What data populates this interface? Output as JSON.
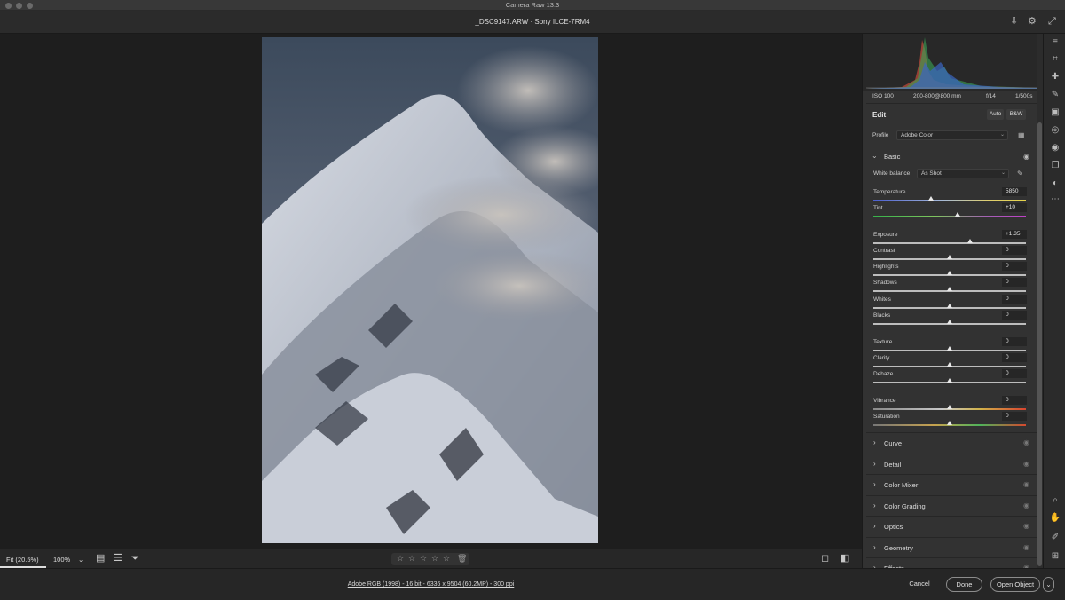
{
  "window": {
    "title": "Camera Raw 13.3"
  },
  "header": {
    "file_title": "_DSC9147.ARW  ·  Sony ILCE-7RM4",
    "save_icon": "save-icon",
    "settings_icon": "gear-icon",
    "fullscreen_icon": "expand-icon"
  },
  "histogram": {
    "iso": "ISO 100",
    "lens": "200-800@800 mm",
    "aperture": "f/14",
    "shutter": "1/500s"
  },
  "edit": {
    "title": "Edit",
    "auto_label": "Auto",
    "bw_label": "B&W",
    "profile_label": "Profile",
    "profile_value": "Adobe Color"
  },
  "basic": {
    "title": "Basic",
    "wb_label": "White balance",
    "wb_value": "As Shot",
    "sliders": [
      {
        "name": "Temperature",
        "value": "5850",
        "position": 0.38
      },
      {
        "name": "Tint",
        "value": "+10",
        "position": 0.55
      },
      {
        "name": "Exposure",
        "value": "+1.35",
        "position": 0.635
      },
      {
        "name": "Contrast",
        "value": "0",
        "position": 0.5
      },
      {
        "name": "Highlights",
        "value": "0",
        "position": 0.5
      },
      {
        "name": "Shadows",
        "value": "0",
        "position": 0.5
      },
      {
        "name": "Whites",
        "value": "0",
        "position": 0.5
      },
      {
        "name": "Blacks",
        "value": "0",
        "position": 0.5
      },
      {
        "name": "Texture",
        "value": "0",
        "position": 0.5
      },
      {
        "name": "Clarity",
        "value": "0",
        "position": 0.5
      },
      {
        "name": "Dehaze",
        "value": "0",
        "position": 0.5
      },
      {
        "name": "Vibrance",
        "value": "0",
        "position": 0.5
      },
      {
        "name": "Saturation",
        "value": "0",
        "position": 0.5
      }
    ]
  },
  "panels": [
    "Curve",
    "Detail",
    "Color Mixer",
    "Color Grading",
    "Optics",
    "Geometry",
    "Effects"
  ],
  "bottombar": {
    "fit_label": "Fit (20.5%)",
    "zoom_label": "100%",
    "zoom_caret": "⌄"
  },
  "footer": {
    "workflow_info": "Adobe RGB (1998) - 16 bit - 6336 x 9504 (60.2MP) - 300 ppi",
    "cancel_label": "Cancel",
    "done_label": "Done",
    "open_label": "Open Object",
    "open_caret": "⌄"
  },
  "toolbar_icons": [
    "sliders-icon",
    "crop-icon",
    "healing-icon",
    "brush-icon",
    "gradient-icon",
    "radial-icon",
    "redeye-icon",
    "snapshots-icon",
    "presets-icon",
    "more-icon",
    "zoom-icon",
    "hand-icon",
    "sampler-icon",
    "grid-icon"
  ]
}
